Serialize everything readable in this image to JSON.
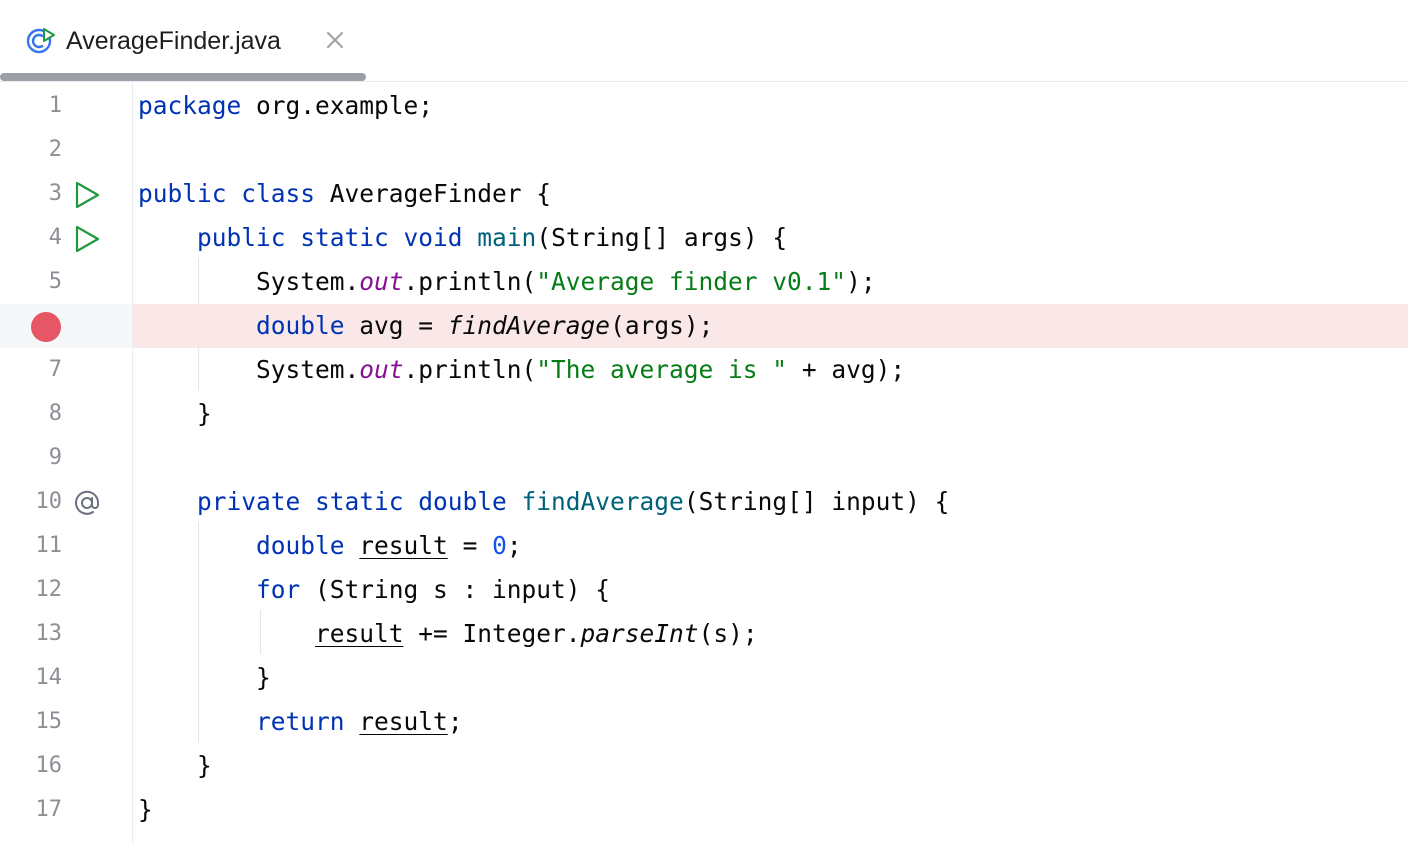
{
  "tab": {
    "title": "AverageFinder.java",
    "icon": "java-class-run-icon",
    "close_icon": "close-icon"
  },
  "colors": {
    "keyword": "#0033b3",
    "string": "#067d17",
    "static_field": "#871094",
    "method_declaration": "#00627a",
    "number": "#1750eb",
    "breakpoint": "#e55765",
    "breakpoint_line_bg": "#fae8e8",
    "run_gutter_icon": "#1f9a3f"
  },
  "editor": {
    "lines": [
      {
        "num": "1",
        "gutter": null,
        "tokens": [
          {
            "t": "package",
            "c": "kw"
          },
          {
            "t": " org.example;"
          }
        ]
      },
      {
        "num": "2",
        "gutter": null,
        "tokens": []
      },
      {
        "num": "3",
        "gutter": "run-icon",
        "tokens": [
          {
            "t": "public class",
            "c": "kw"
          },
          {
            "t": " AverageFinder {"
          }
        ]
      },
      {
        "num": "4",
        "gutter": "run-icon",
        "tokens": [
          {
            "t": "    "
          },
          {
            "t": "public static void",
            "c": "kw"
          },
          {
            "t": " "
          },
          {
            "t": "main",
            "c": "mdecl"
          },
          {
            "t": "(String[] args) {"
          }
        ]
      },
      {
        "num": "5",
        "gutter": null,
        "tokens": [
          {
            "t": "        System."
          },
          {
            "t": "out",
            "c": "fld"
          },
          {
            "t": ".println("
          },
          {
            "t": "\"Average finder v0.1\"",
            "c": "str"
          },
          {
            "t": ");"
          }
        ]
      },
      {
        "num": "",
        "gutter": "breakpoint-icon",
        "breakpoint": true,
        "tokens": [
          {
            "t": "        "
          },
          {
            "t": "double",
            "c": "kw"
          },
          {
            "t": " avg = "
          },
          {
            "t": "findAverage",
            "c": "ital"
          },
          {
            "t": "(args);"
          }
        ]
      },
      {
        "num": "7",
        "gutter": null,
        "tokens": [
          {
            "t": "        System."
          },
          {
            "t": "out",
            "c": "fld"
          },
          {
            "t": ".println("
          },
          {
            "t": "\"The average is \"",
            "c": "str"
          },
          {
            "t": " + avg);"
          }
        ]
      },
      {
        "num": "8",
        "gutter": null,
        "tokens": [
          {
            "t": "    }"
          }
        ]
      },
      {
        "num": "9",
        "gutter": null,
        "tokens": []
      },
      {
        "num": "10",
        "gutter": "usages-icon",
        "tokens": [
          {
            "t": "    "
          },
          {
            "t": "private static double",
            "c": "kw"
          },
          {
            "t": " "
          },
          {
            "t": "findAverage",
            "c": "mdecl"
          },
          {
            "t": "(String[] input) {"
          }
        ]
      },
      {
        "num": "11",
        "gutter": null,
        "tokens": [
          {
            "t": "        "
          },
          {
            "t": "double",
            "c": "kw"
          },
          {
            "t": " "
          },
          {
            "t": "result",
            "c": "ul"
          },
          {
            "t": " = "
          },
          {
            "t": "0",
            "c": "num"
          },
          {
            "t": ";"
          }
        ]
      },
      {
        "num": "12",
        "gutter": null,
        "tokens": [
          {
            "t": "        "
          },
          {
            "t": "for",
            "c": "kw"
          },
          {
            "t": " (String s : input) {"
          }
        ]
      },
      {
        "num": "13",
        "gutter": null,
        "tokens": [
          {
            "t": "            "
          },
          {
            "t": "result",
            "c": "ul"
          },
          {
            "t": " += Integer."
          },
          {
            "t": "parseInt",
            "c": "ital"
          },
          {
            "t": "(s);"
          }
        ]
      },
      {
        "num": "14",
        "gutter": null,
        "tokens": [
          {
            "t": "        }"
          }
        ]
      },
      {
        "num": "15",
        "gutter": null,
        "tokens": [
          {
            "t": "        "
          },
          {
            "t": "return",
            "c": "kw"
          },
          {
            "t": " "
          },
          {
            "t": "result",
            "c": "ul"
          },
          {
            "t": ";"
          }
        ]
      },
      {
        "num": "16",
        "gutter": null,
        "tokens": [
          {
            "t": "    }"
          }
        ]
      },
      {
        "num": "17",
        "gutter": null,
        "tokens": [
          {
            "t": "}"
          }
        ]
      }
    ]
  }
}
